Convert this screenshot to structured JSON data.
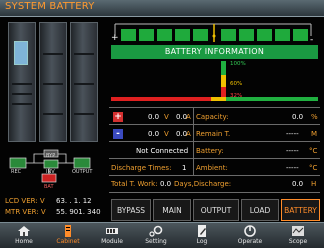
{
  "title": "SYSTEM BATTERY",
  "battery_info": {
    "header": "BATTERY INFORMATION",
    "levels": {
      "high": "100%",
      "mid": "60%",
      "low": "32%"
    },
    "positive": {
      "sign": "+",
      "voltage": "0.0",
      "v_unit": "V",
      "current": "0.0",
      "a_unit": "A"
    },
    "negative": {
      "sign": "-",
      "voltage": "0.0",
      "v_unit": "V",
      "current": "0.0",
      "a_unit": "A"
    },
    "capacity_label": "Capacity:",
    "capacity_value": "0.0",
    "capacity_unit": "%",
    "remain_label": "Remain T.",
    "remain_value": "-----",
    "remain_unit": "M",
    "battery_label": "Battery:",
    "battery_value": "-----",
    "battery_unit": "°C",
    "ambient_label": "Ambient:",
    "ambient_value": "-----",
    "ambient_unit": "°C",
    "status": "Not Connected",
    "discharge_label": "Discharge Times:",
    "discharge_value": "1",
    "work_label": "Total T. Work:",
    "work_value": "0.0",
    "days_label": "Days,Discharge:",
    "days_value": "0.0",
    "days_unit": "H"
  },
  "versions": {
    "lcd_label": "LCD VER: V",
    "lcd_value": "63. . 1. 12",
    "mtr_label": "MTR VER: V",
    "mtr_value": "55. 901. 340"
  },
  "diagram_labels": {
    "byp": "BYP",
    "rec": "REC",
    "inv": "INV",
    "output": "OUTPUT",
    "bat": "BAT"
  },
  "mode_buttons": [
    {
      "label": "BYPASS"
    },
    {
      "label": "MAIN"
    },
    {
      "label": "OUTPUT"
    },
    {
      "label": "LOAD"
    },
    {
      "label": "BATTERY"
    }
  ],
  "nav": [
    {
      "label": "Home",
      "icon": "home-icon"
    },
    {
      "label": "Cabinet",
      "icon": "cabinet-icon",
      "active": true
    },
    {
      "label": "Module",
      "icon": "module-icon"
    },
    {
      "label": "Setting",
      "icon": "setting-icon"
    },
    {
      "label": "Log",
      "icon": "log-icon"
    },
    {
      "label": "Operate",
      "icon": "operate-icon"
    },
    {
      "label": "Scope",
      "icon": "scope-icon"
    }
  ],
  "colors": {
    "accent": "#ff8c2a",
    "header_green": "#1a9a42",
    "battery_green": "#1faa3c",
    "level_red": "#e02020",
    "level_yellow": "#f0c000",
    "level_green": "#20b040"
  }
}
